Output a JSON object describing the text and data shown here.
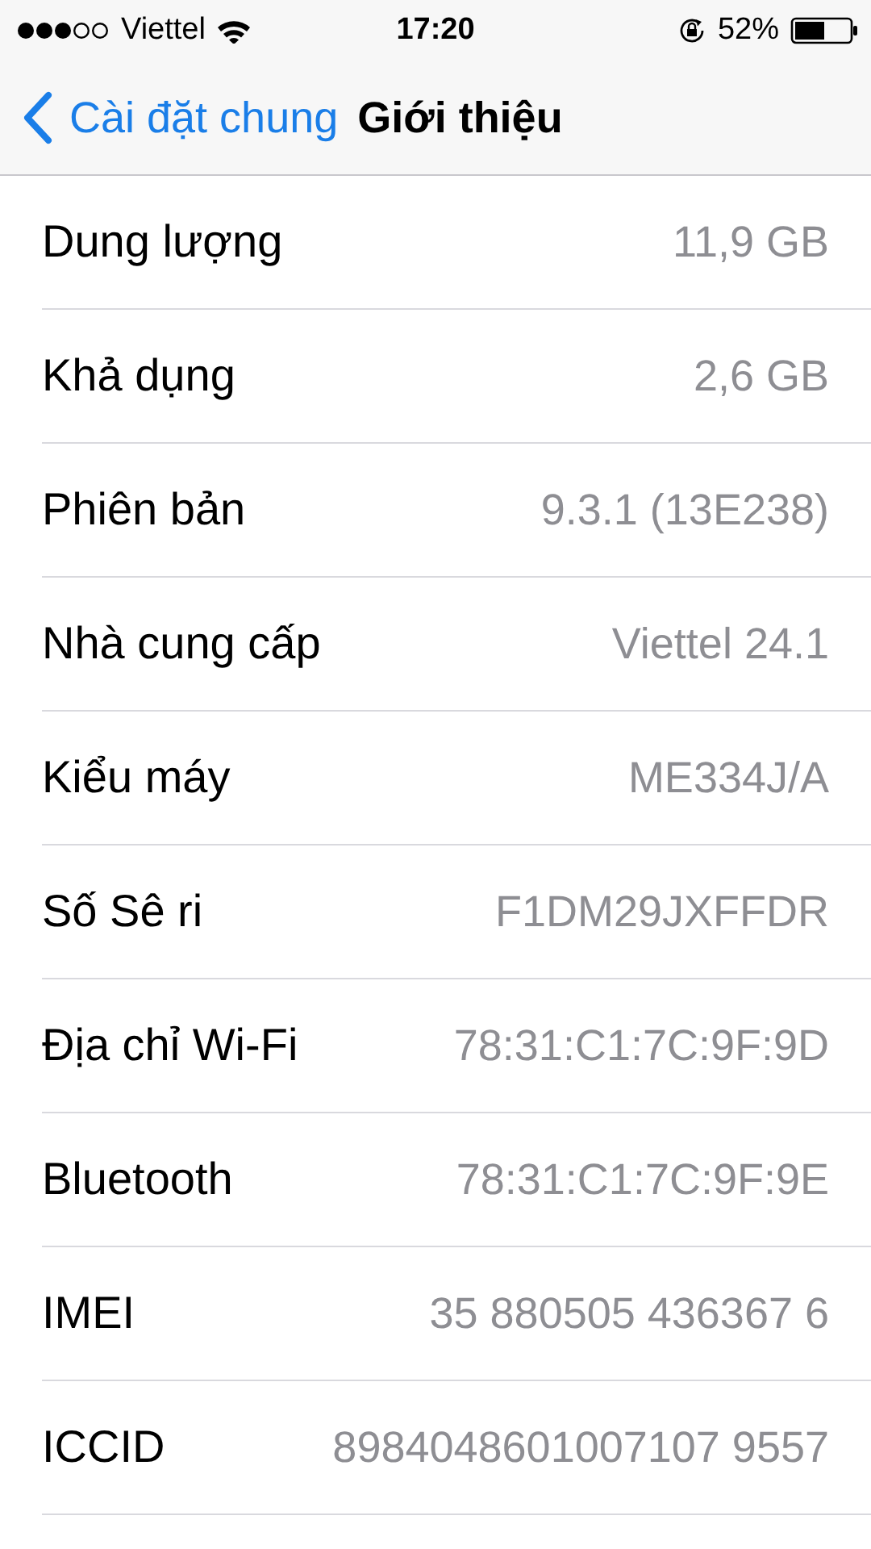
{
  "status_bar": {
    "carrier": "Viettel",
    "time": "17:20",
    "battery_percent": "52%"
  },
  "nav_bar": {
    "back_label": "Cài đặt chung",
    "title": "Giới thiệu"
  },
  "rows": [
    {
      "label": "Dung lượng",
      "value": "11,9 GB"
    },
    {
      "label": "Khả dụng",
      "value": "2,6 GB"
    },
    {
      "label": "Phiên bản",
      "value": "9.3.1 (13E238)"
    },
    {
      "label": "Nhà cung cấp",
      "value": "Viettel 24.1"
    },
    {
      "label": "Kiểu máy",
      "value": "ME334J/A"
    },
    {
      "label": "Số Sê ri",
      "value": "F1DM29JXFFDR"
    },
    {
      "label": "Địa chỉ Wi-Fi",
      "value": "78:31:C1:7C:9F:9D"
    },
    {
      "label": "Bluetooth",
      "value": "78:31:C1:7C:9F:9E"
    },
    {
      "label": "IMEI",
      "value": "35 880505 436367 6"
    },
    {
      "label": "ICCID",
      "value": "8984048601007107 9557"
    }
  ]
}
